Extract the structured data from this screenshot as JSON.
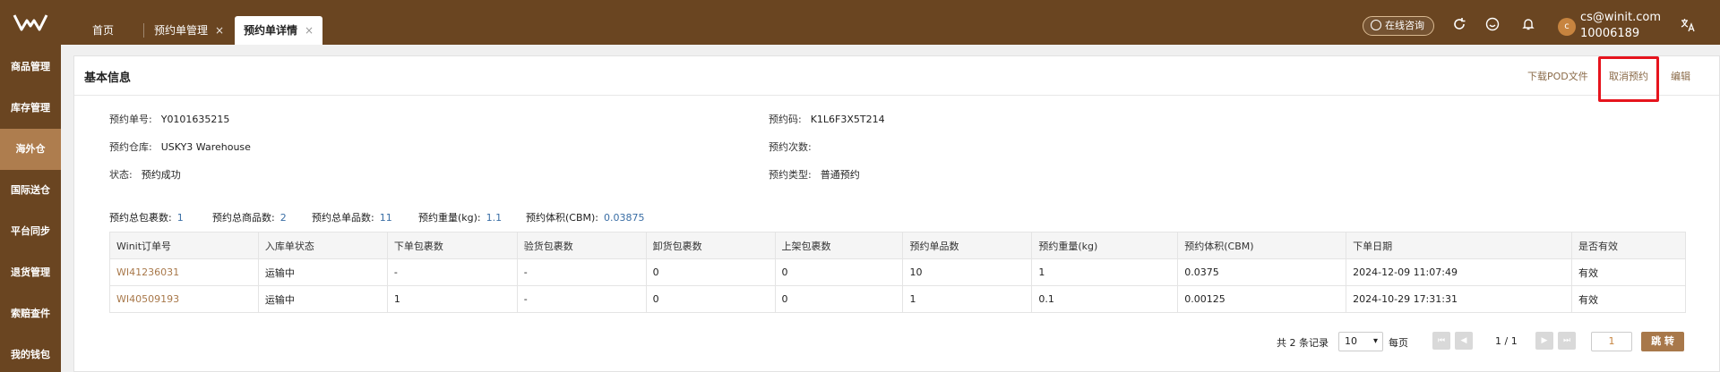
{
  "header": {
    "logo": "winit-logo",
    "tabs": [
      {
        "label": "首页"
      },
      {
        "label": "预约单管理",
        "close": "×"
      },
      {
        "label": "预约单详情",
        "close": "×",
        "active": true
      }
    ],
    "consult_label": "在线咨询",
    "user": {
      "avatar": "c",
      "email": "cs@winit.com",
      "id": "10006189"
    }
  },
  "sidebar": {
    "items": [
      {
        "label": "商品管理"
      },
      {
        "label": "库存管理"
      },
      {
        "label": "海外仓",
        "active": true
      },
      {
        "label": "国际送仓"
      },
      {
        "label": "平台同步"
      },
      {
        "label": "退货管理"
      },
      {
        "label": "索赔查件"
      },
      {
        "label": "我的钱包"
      }
    ]
  },
  "panel": {
    "title": "基本信息",
    "actions": {
      "download_pod": "下载POD文件",
      "cancel": "取消预约",
      "edit": "编辑"
    },
    "info": {
      "order_no_label": "预约单号:",
      "order_no": "Y0101635215",
      "warehouse_label": "预约仓库:",
      "warehouse": "USKY3 Warehouse",
      "status_label": "状态:",
      "status": "预约成功",
      "code_label": "预约码:",
      "code": "K1L6F3X5T214",
      "times_label": "预约次数:",
      "times": "",
      "type_label": "预约类型:",
      "type": "普通预约"
    },
    "summary": {
      "total_packages_label": "预约总包裹数:",
      "total_packages": "1",
      "total_goods_label": "预约总商品数:",
      "total_goods": "2",
      "total_items_label": "预约总单品数:",
      "total_items": "11",
      "weight_label": "预约重量(kg):",
      "weight": "1.1",
      "volume_label": "预约体积(CBM):",
      "volume": "0.03875"
    },
    "table": {
      "columns": [
        "Winit订单号",
        "入库单状态",
        "下单包裹数",
        "验货包裹数",
        "卸货包裹数",
        "上架包裹数",
        "预约单品数",
        "预约重量(kg)",
        "预约体积(CBM)",
        "下单日期",
        "是否有效"
      ],
      "rows": [
        [
          "WI41236031",
          "运输中",
          "-",
          "-",
          "0",
          "0",
          "10",
          "1",
          "0.0375",
          "2024-12-09 11:07:49",
          "有效"
        ],
        [
          "WI40509193",
          "运输中",
          "1",
          "-",
          "0",
          "0",
          "1",
          "0.1",
          "0.00125",
          "2024-10-29 17:31:31",
          "有效"
        ]
      ]
    },
    "pagination": {
      "total_text": "共 2 条记录",
      "page_size": "10",
      "per_page": "每页",
      "page_info": "1 / 1",
      "page_input": "1",
      "go_label": "跳 转"
    }
  }
}
